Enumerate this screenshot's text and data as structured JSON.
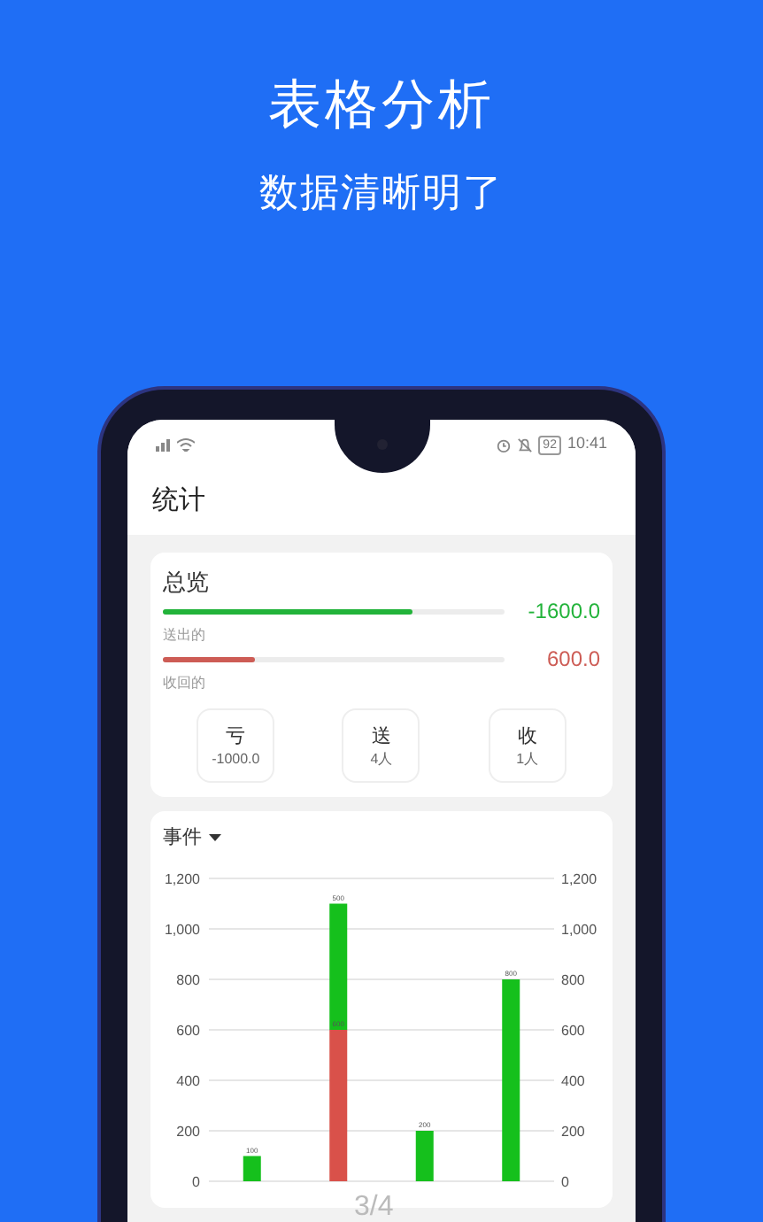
{
  "promo": {
    "title": "表格分析",
    "subtitle": "数据清晰明了"
  },
  "status_bar": {
    "battery": "92",
    "time": "10:41"
  },
  "header": {
    "title": "统计"
  },
  "overview": {
    "title": "总览",
    "bars": [
      {
        "label": "送出的",
        "value": "-1600.0",
        "level": 0.73,
        "color": "#22b33a"
      },
      {
        "label": "收回的",
        "value": "600.0",
        "level": 0.27,
        "color": "#cd5c55"
      }
    ],
    "stats": [
      {
        "label": "亏",
        "value": "-1000.0"
      },
      {
        "label": "送",
        "value": "4人"
      },
      {
        "label": "收",
        "value": "1人"
      }
    ]
  },
  "events": {
    "dropdown": "事件",
    "chart_data": {
      "type": "bar",
      "stacked": true,
      "grid": true,
      "ylim": [
        0,
        1200
      ],
      "yticks": [
        {
          "value": 0,
          "label": "0"
        },
        {
          "value": 200,
          "label": "200"
        },
        {
          "value": 400,
          "label": "400"
        },
        {
          "value": 600,
          "label": "600"
        },
        {
          "value": 800,
          "label": "800"
        },
        {
          "value": 1000,
          "label": "1,000"
        },
        {
          "value": 1200,
          "label": "1,200"
        }
      ],
      "series": [
        {
          "color": "#d9514a",
          "values": [
            0,
            600,
            0,
            0
          ],
          "value_labels": [
            null,
            "600",
            null,
            null
          ]
        },
        {
          "color": "#15c01c",
          "values": [
            100,
            500,
            200,
            800
          ],
          "value_labels": [
            "100",
            "500",
            "200",
            "800"
          ]
        }
      ]
    }
  },
  "page_indicator": "3/4"
}
